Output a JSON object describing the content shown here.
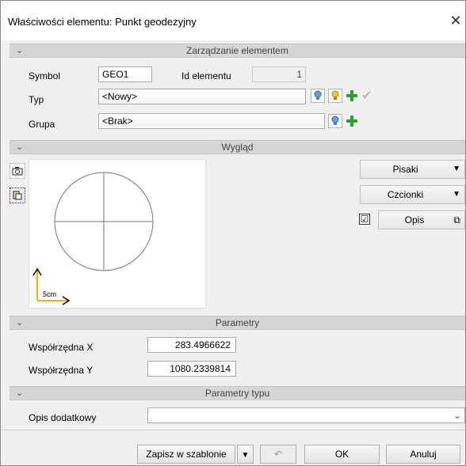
{
  "window": {
    "title": "Właściwości elementu: Punkt geodezyjny",
    "close_label": "✕"
  },
  "sections": {
    "management": "Zarządzanie elementem",
    "appearance": "Wygląd",
    "parameters": "Parametry",
    "type_parameters": "Parametry typu"
  },
  "management": {
    "symbol_label": "Symbol",
    "symbol_value": "GEO1",
    "id_label": "Id elementu",
    "id_value": "1",
    "type_label": "Typ",
    "type_value": "<Nowy>",
    "group_label": "Grupa",
    "group_value": "<Brak>"
  },
  "appearance": {
    "pens_label": "Pisaki",
    "fonts_label": "Czcionki",
    "description_label": "Opis",
    "description_checked": "☑",
    "scale_label": "5cm"
  },
  "parameters": {
    "x_label": "Współrzędna X",
    "x_value": "283.4966622",
    "y_label": "Współrzędna Y",
    "y_value": "1080.2339814"
  },
  "type_parameters": {
    "extra_desc_label": "Opis dodatkowy",
    "extra_desc_value": ""
  },
  "footer": {
    "save_template": "Zapisz w szablonie",
    "ok": "OK",
    "cancel": "Anuluj"
  },
  "colors": {
    "accent_green": "#2ea02e",
    "header_gray": "#d6d6d6"
  },
  "icons": [
    "close-icon",
    "chevron-down-icon",
    "lightbulb-icon",
    "plus-icon",
    "checkmark-icon",
    "camera-icon",
    "layers-icon",
    "dropdown-caret-icon",
    "edit-icon",
    "undo-icon"
  ]
}
